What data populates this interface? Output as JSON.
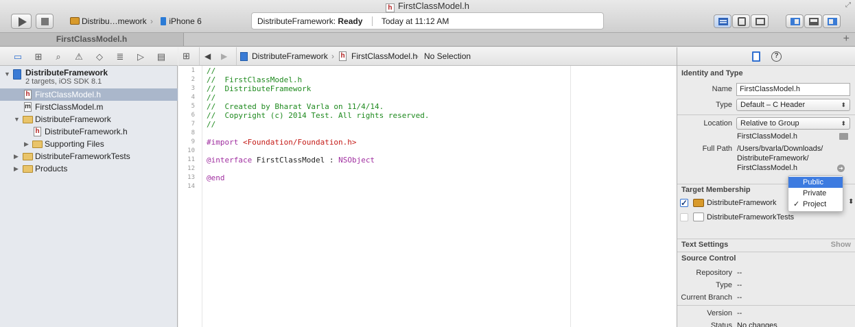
{
  "window": {
    "title": "FirstClassModel.h"
  },
  "toolbar": {
    "scheme": "Distribu…mework",
    "device": "iPhone 6",
    "activity_project": "DistributeFramework:",
    "activity_status": "Ready",
    "activity_time": "Today at 11:12 AM"
  },
  "tab": {
    "label": "FirstClassModel.h",
    "add": "+"
  },
  "navigator": {
    "project_name": "DistributeFramework",
    "project_sub": "2 targets, iOS SDK 8.1",
    "items": [
      {
        "label": "FirstClassModel.h"
      },
      {
        "label": "FirstClassModel.m"
      },
      {
        "label": "DistributeFramework"
      },
      {
        "label": "DistributeFramework.h"
      },
      {
        "label": "Supporting Files"
      },
      {
        "label": "DistributeFrameworkTests"
      },
      {
        "label": "Products"
      }
    ]
  },
  "jumpbar": {
    "project": "DistributeFramework",
    "file": "FirstClassModel.h",
    "selection": "No Selection"
  },
  "editor": {
    "line_numbers": [
      "1",
      "2",
      "3",
      "4",
      "5",
      "6",
      "7",
      "8",
      "9",
      "10",
      "11",
      "12",
      "13",
      "14"
    ],
    "lines": [
      {
        "text": "//"
      },
      {
        "text": "//  FirstClassModel.h"
      },
      {
        "text": "//  DistributeFramework"
      },
      {
        "text": "//"
      },
      {
        "text": "//  Created by Bharat Varla on 11/4/14."
      },
      {
        "text": "//  Copyright (c) 2014 Test. All rights reserved."
      },
      {
        "text": "//"
      },
      {
        "text": ""
      },
      {
        "import_kw": "#import",
        "import_path": "<Foundation/Foundation.h>"
      },
      {
        "text": ""
      },
      {
        "iface_kw": "@interface",
        "iface_name": " FirstClassModel : ",
        "iface_super": "NSObject"
      },
      {
        "text": ""
      },
      {
        "end_kw": "@end"
      },
      {
        "text": ""
      }
    ]
  },
  "inspector": {
    "identity": {
      "header": "Identity and Type",
      "name_label": "Name",
      "name_value": "FirstClassModel.h",
      "type_label": "Type",
      "type_value": "Default – C Header",
      "location_label": "Location",
      "location_value": "Relative to Group",
      "location_file": "FirstClassModel.h",
      "fullpath_label": "Full Path",
      "fullpath_1": "/Users/bvarla/Downloads/",
      "fullpath_2": "DistributeFramework/",
      "fullpath_3": "FirstClassModel.h"
    },
    "membership": {
      "header": "Target Membership",
      "targets": [
        {
          "name": "DistributeFramework",
          "checked": true
        },
        {
          "name": "DistributeFrameworkTests",
          "checked": false
        }
      ]
    },
    "text_settings": {
      "header": "Text Settings",
      "show": "Show"
    },
    "source_control": {
      "header": "Source Control",
      "repository_label": "Repository",
      "repository_value": "--",
      "type_label": "Type",
      "type_value": "--",
      "branch_label": "Current Branch",
      "branch_value": "--",
      "version_label": "Version",
      "version_value": "--",
      "status_label": "Status",
      "status_value": "No changes"
    }
  },
  "menu": {
    "items": [
      {
        "label": "Public",
        "highlighted": true,
        "checked": false
      },
      {
        "label": "Private",
        "highlighted": false,
        "checked": false
      },
      {
        "label": "Project",
        "highlighted": false,
        "checked": true
      }
    ],
    "check": "✓"
  },
  "colors": {
    "accent": "#3d7be0",
    "selection": "#aab7cb",
    "comment": "#1f8a1f",
    "keyword": "#a02fa0",
    "string": "#c41a16"
  }
}
